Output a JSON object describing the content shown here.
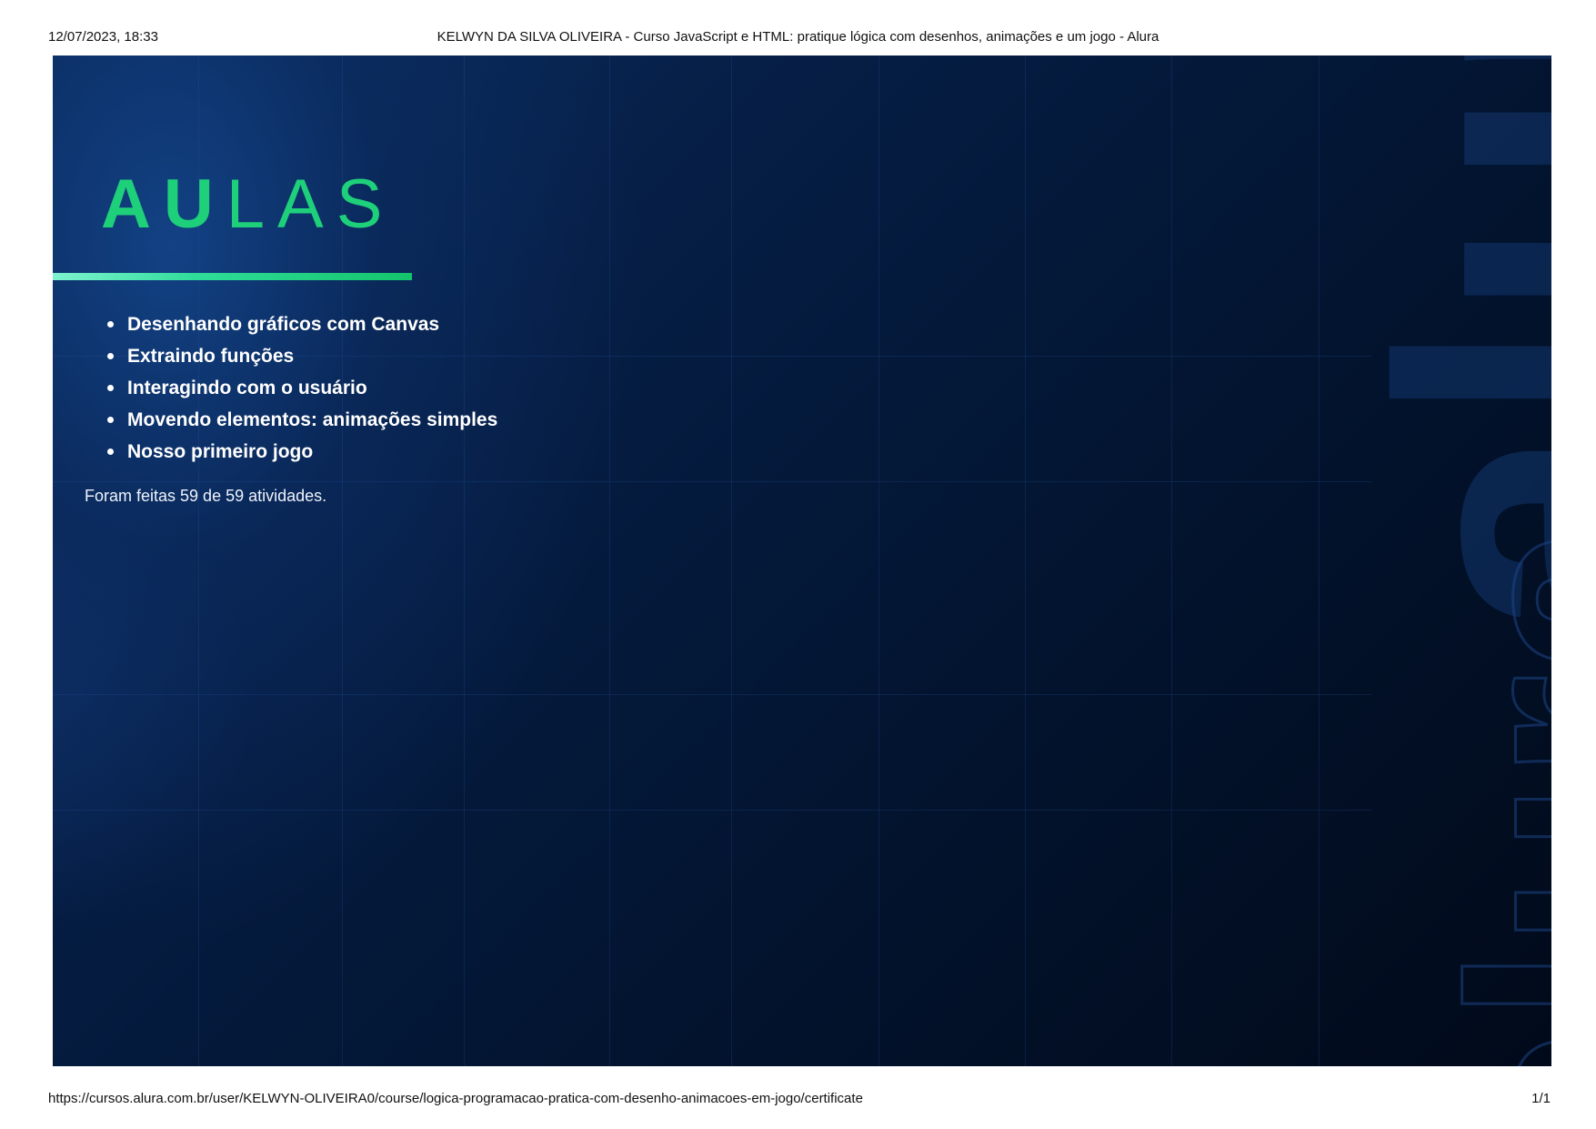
{
  "print_header": {
    "date": "12/07/2023, 18:33",
    "title": "KELWYN DA SILVA OLIVEIRA - Curso JavaScript e HTML: pratique lógica com desenhos, animações e um jogo - Alura"
  },
  "print_footer": {
    "url": "https://cursos.alura.com.br/user/KELWYN-OLIVEIRA0/course/logica-programacao-pratica-com-desenho-animacoes-em-jogo/certificate",
    "page": "1/1"
  },
  "certificate": {
    "heading_bold": "AU",
    "heading_light": "LAS",
    "lessons": [
      "Desenhando gráficos com Canvas",
      "Extraindo funções",
      "Interagindo com o usuário",
      "Movendo elementos: animações simples",
      "Nosso primeiro jogo"
    ],
    "activities": "Foram feitas 59 de 59 atividades.",
    "watermark_top": "alura",
    "watermark_bottom": "alura"
  },
  "colors": {
    "accent": "#1ed07a",
    "background_dark": "#021634",
    "background_light": "#0a2f63",
    "text": "#ffffff"
  }
}
